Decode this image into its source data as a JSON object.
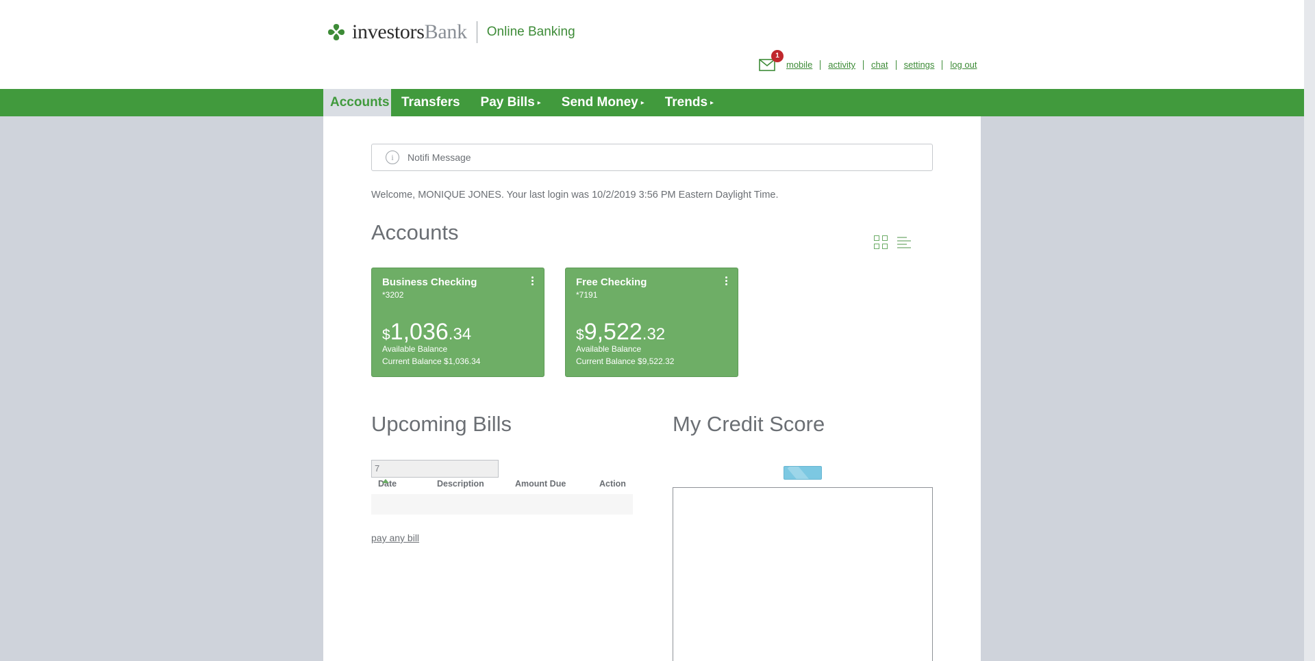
{
  "header": {
    "brand_name": "investors",
    "brand_bank": "Bank",
    "subtitle": "Online Banking",
    "mail_badge_count": "1",
    "utility_links": [
      "mobile",
      "activity",
      "chat",
      "settings",
      "log out"
    ]
  },
  "nav": {
    "items": [
      {
        "label": "Accounts",
        "active": true,
        "has_menu": false
      },
      {
        "label": "Transfers",
        "active": false,
        "has_menu": false
      },
      {
        "label": "Pay Bills",
        "active": false,
        "has_menu": true
      },
      {
        "label": "Send Money",
        "active": false,
        "has_menu": true
      },
      {
        "label": "Trends",
        "active": false,
        "has_menu": true
      }
    ]
  },
  "notification": {
    "text": "Notifi Message",
    "icon": "info-icon"
  },
  "welcome_text": "Welcome, MONIQUE JONES. Your last login was 10/2/2019 3:56 PM Eastern Daylight Time.",
  "accounts": {
    "title": "Accounts",
    "view_icons": [
      "grid-view-icon",
      "list-view-icon"
    ],
    "cards": [
      {
        "name": "Business Checking",
        "number": "*3202",
        "currency": "$",
        "balance_whole": "1,036",
        "balance_cents": ".34",
        "available_label": "Available Balance",
        "current_balance": "Current Balance $1,036.34"
      },
      {
        "name": "Free Checking",
        "number": "*7191",
        "currency": "$",
        "balance_whole": "9,522",
        "balance_cents": ".32",
        "available_label": "Available Balance",
        "current_balance": "Current Balance $9,522.32"
      }
    ]
  },
  "bills": {
    "title": "Upcoming Bills",
    "filter_value": "7",
    "columns": [
      "Date",
      "Description",
      "Amount Due",
      "Action"
    ],
    "rows": [],
    "pay_link": "pay any bill"
  },
  "credit": {
    "title": "My Credit Score"
  },
  "colors": {
    "brand_green": "#419a3d",
    "card_green": "#6eae66",
    "badge_red": "#c0282d",
    "background": "#cfd3db"
  }
}
